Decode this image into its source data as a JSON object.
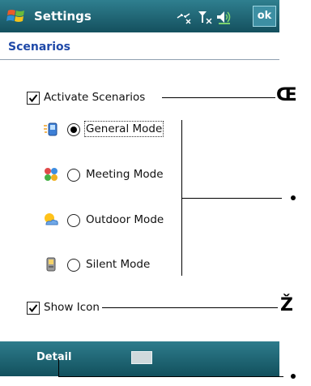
{
  "titlebar": {
    "app_title": "Settings",
    "ok_label": "ok"
  },
  "page": {
    "title": "Scenarios"
  },
  "activate": {
    "label": "Activate Scenarios",
    "checked": true
  },
  "modes": [
    {
      "label": "General Mode",
      "selected": true,
      "icon": "general-mode-icon"
    },
    {
      "label": "Meeting Mode",
      "selected": false,
      "icon": "meeting-mode-icon"
    },
    {
      "label": "Outdoor Mode",
      "selected": false,
      "icon": "outdoor-mode-icon"
    },
    {
      "label": "Silent Mode",
      "selected": false,
      "icon": "silent-mode-icon"
    }
  ],
  "show_icon": {
    "label": "Show  Icon",
    "checked": true
  },
  "bottombar": {
    "left_softkey": "Detail",
    "keyboard_icon": "keyboard-icon"
  },
  "callouts": {
    "c1": "Œ",
    "c3": "Ž"
  },
  "colors": {
    "titlebar": "#1b6575",
    "page_title": "#1f49a8"
  }
}
